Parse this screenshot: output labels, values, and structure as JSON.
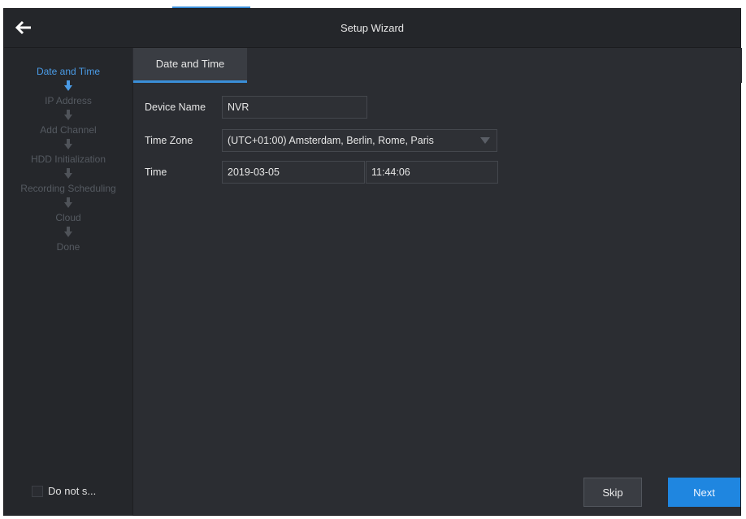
{
  "window": {
    "title": "Setup Wizard"
  },
  "sidebar": {
    "steps": [
      {
        "label": "Date and Time",
        "active": true
      },
      {
        "label": "IP Address",
        "active": false
      },
      {
        "label": "Add Channel",
        "active": false
      },
      {
        "label": "HDD Initialization",
        "active": false
      },
      {
        "label": "Recording Scheduling",
        "active": false
      },
      {
        "label": "Cloud",
        "active": false
      },
      {
        "label": "Done",
        "active": false
      }
    ],
    "dont_show_label": "Do not s..."
  },
  "tabs": [
    {
      "label": "Date and Time",
      "active": true
    }
  ],
  "form": {
    "device_name": {
      "label": "Device Name",
      "value": "NVR"
    },
    "time_zone": {
      "label": "Time Zone",
      "value": "(UTC+01:00) Amsterdam, Berlin, Rome, Paris"
    },
    "time": {
      "label": "Time",
      "date_value": "2019-03-05",
      "time_value": "11:44:06"
    }
  },
  "buttons": {
    "skip": "Skip",
    "next": "Next"
  },
  "colors": {
    "accent": "#1f86e0",
    "active_step": "#4a9be6",
    "background": "#2b2d32"
  },
  "icons": {
    "back": "arrow-left-icon",
    "step_arrow": "arrow-down-icon",
    "dropdown": "dropdown-arrow-icon"
  }
}
